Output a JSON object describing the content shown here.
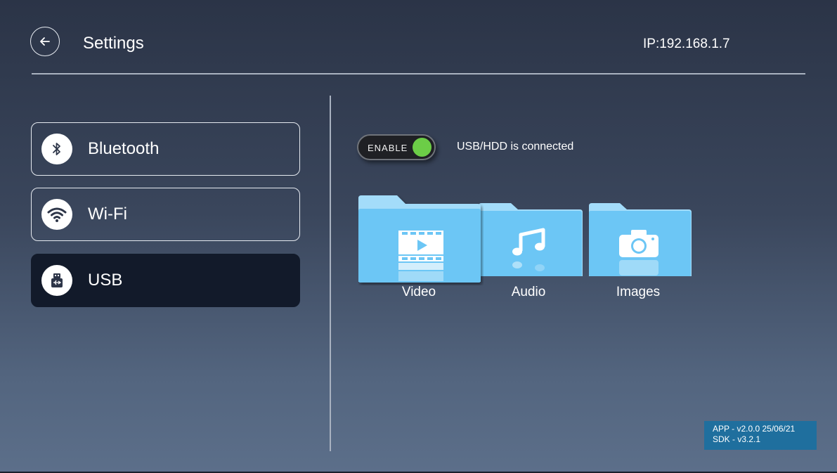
{
  "header": {
    "title": "Settings",
    "ip": "IP:192.168.1.7",
    "back_icon": "arrow-left-icon"
  },
  "sidebar": {
    "items": [
      {
        "label": "Bluetooth",
        "icon": "bluetooth-icon",
        "active": false
      },
      {
        "label": "Wi-Fi",
        "icon": "wifi-icon",
        "active": false
      },
      {
        "label": "USB",
        "icon": "usb-icon",
        "active": true
      }
    ]
  },
  "usb_panel": {
    "toggle_label": "ENABLE",
    "toggle_on": true,
    "status": "USB/HDD is connected",
    "folders": [
      {
        "label": "Video",
        "icon": "video-icon",
        "selected": true
      },
      {
        "label": "Audio",
        "icon": "music-note-icon",
        "selected": false
      },
      {
        "label": "Images",
        "icon": "camera-icon",
        "selected": false
      }
    ]
  },
  "version": {
    "app": "APP - v2.0.0 25/06/21",
    "sdk": "SDK - v3.2.1"
  },
  "colors": {
    "accent_green": "#6ccd47",
    "folder_blue": "#6cc6f5",
    "active_item": "#121a2a",
    "version_bg": "#1f6f9e"
  }
}
